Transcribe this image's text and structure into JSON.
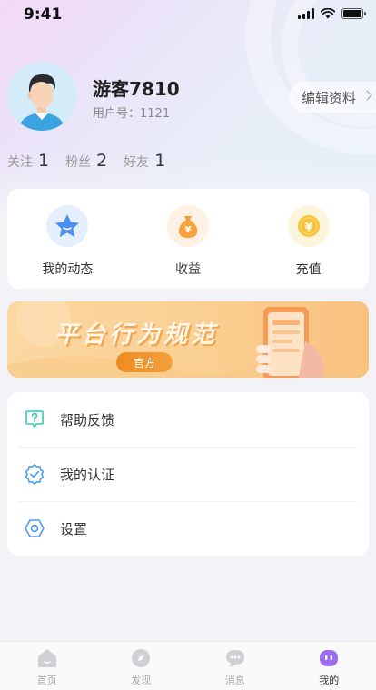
{
  "status_bar": {
    "time": "9:41"
  },
  "profile": {
    "username": "游客7810",
    "user_id_label": "用户号：1121",
    "edit_label": "编辑资料"
  },
  "stats": [
    {
      "label": "关注",
      "value": "1"
    },
    {
      "label": "粉丝",
      "value": "2"
    },
    {
      "label": "好友",
      "value": "1"
    }
  ],
  "quick_actions": [
    {
      "label": "我的动态",
      "icon": "star-icon"
    },
    {
      "label": "收益",
      "icon": "money-bag-icon"
    },
    {
      "label": "充值",
      "icon": "yen-coin-icon"
    }
  ],
  "banner": {
    "title": "平台行为规范",
    "badge": "官方"
  },
  "menu": [
    {
      "label": "帮助反馈",
      "icon": "help-chat-icon"
    },
    {
      "label": "我的认证",
      "icon": "verified-badge-icon"
    },
    {
      "label": "设置",
      "icon": "settings-hexagon-icon"
    }
  ],
  "tabs": [
    {
      "label": "首页",
      "icon": "home-icon"
    },
    {
      "label": "发现",
      "icon": "compass-icon"
    },
    {
      "label": "消息",
      "icon": "chat-bubble-icon"
    },
    {
      "label": "我的",
      "icon": "profile-face-icon",
      "active": true
    }
  ],
  "colors": {
    "accent_purple": "#9b6cf0",
    "menu_icon_teal": "#3cc7b4",
    "menu_icon_blue": "#4a9df0",
    "banner_orange": "#f4a03b"
  }
}
